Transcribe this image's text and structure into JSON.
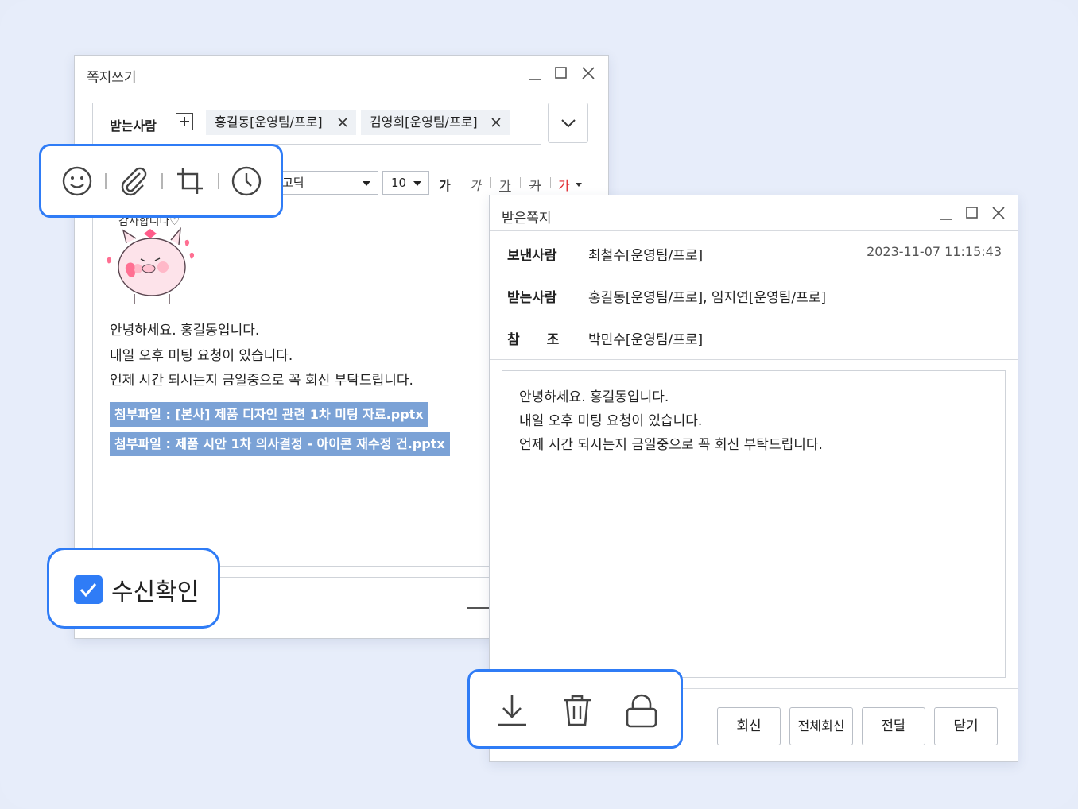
{
  "compose": {
    "title": "쪽지쓰기",
    "recipients_label": "받는사람",
    "recipients": [
      "홍길동[운영팀/프로]",
      "김영희[운영팀/프로]"
    ],
    "font": "고딕",
    "font_size": "10",
    "format_buttons": [
      "가",
      "가",
      "가",
      "가",
      "가"
    ],
    "sticker_text": "감사합니다♡",
    "body_lines": [
      "안녕하세요. 홍길동입니다.",
      "내일 오후 미팅 요청이 있습니다.",
      "언제 시간 되시는지 금일중으로 꼭 회신 부탁드립니다."
    ],
    "attachments": [
      "첨부파일 : [본사] 제품 디자인 관련 1차 미팅 자료.pptx",
      "첨부파일 : 제품 시안 1차 의사결정 - 아이콘 재수정 건.pptx"
    ],
    "read_receipt_label": "수신확인",
    "read_receipt_checked": true
  },
  "toolbar_icons": [
    "emoji-icon",
    "paperclip-icon",
    "crop-icon",
    "clock-icon"
  ],
  "received": {
    "title": "받은쪽지",
    "sender_label": "보낸사람",
    "sender": "최철수[운영팀/프로]",
    "date": "2023-11-07 11:15:43",
    "recipients_label": "받는사람",
    "recipients": "홍길동[운영팀/프로], 임지연[운영팀/프로]",
    "cc_label": "참　　조",
    "cc": "박민수[운영팀/프로]",
    "body_lines": [
      "안녕하세요. 홍길동입니다.",
      "내일 오후 미팅 요청이 있습니다.",
      "언제 시간 되시는지 금일중으로 꼭 회신 부탁드립니다."
    ],
    "buttons": [
      "회신",
      "전체회신",
      "전달",
      "닫기"
    ],
    "action_icons": [
      "download-icon",
      "trash-icon",
      "lock-icon"
    ]
  },
  "colors": {
    "accent": "#2f7cf6",
    "attachment_highlight": "#7ba2d6",
    "background": "#e7edfa"
  }
}
